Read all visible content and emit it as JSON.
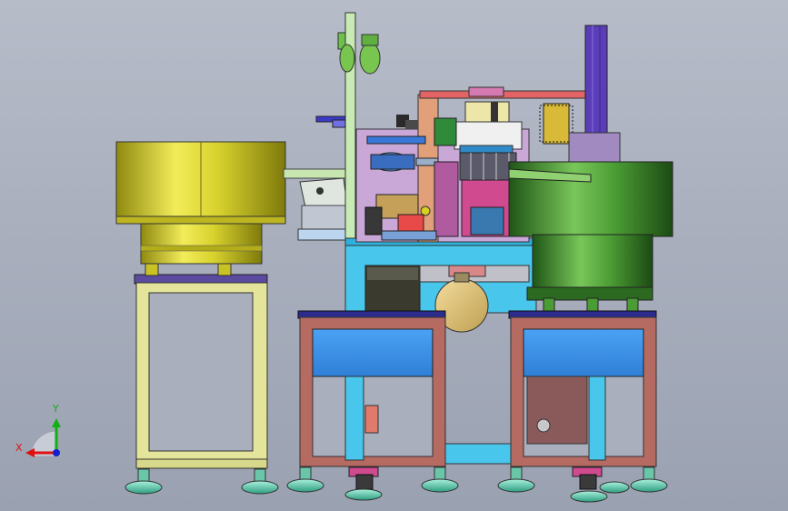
{
  "viewport": {
    "view": "front",
    "background_top": "#b7bcc9",
    "background_bottom": "#9aa1b1"
  },
  "triad": {
    "x_label": "X",
    "y_label": "Y",
    "x_color": "#e01010",
    "y_color": "#10b010",
    "z_color": "#1020d0"
  },
  "colors": {
    "bowl_left": "#c9c224",
    "bowl_right": "#3e8f2a",
    "stand_yellow": "#e4e49a",
    "cabinet_frame": "#b56a62",
    "cabinet_panel": "#3c8fe8",
    "base_cyan": "#48c6ec",
    "feet": "#5ed6b6"
  }
}
